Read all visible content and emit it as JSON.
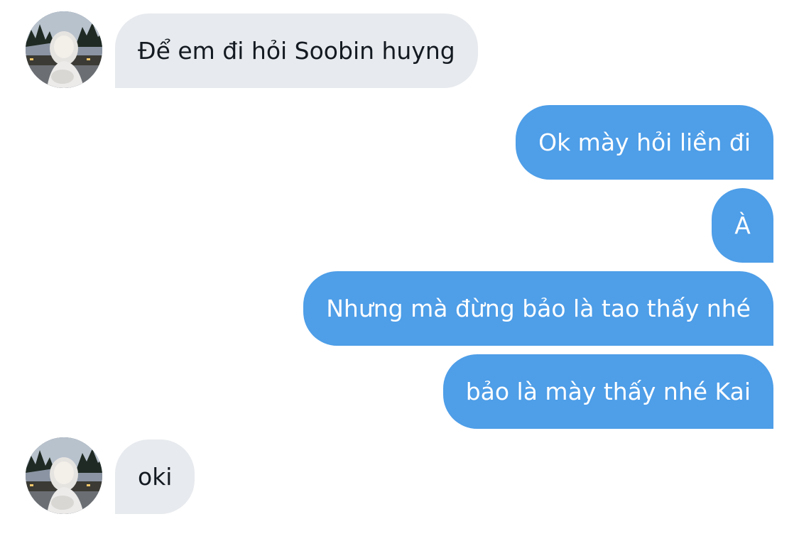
{
  "conversation": {
    "messages": [
      {
        "direction": "incoming",
        "text": "Để em đi hỏi Soobin huyng"
      },
      {
        "direction": "outgoing",
        "text": "Ok mày hỏi liền đi"
      },
      {
        "direction": "outgoing",
        "text": "À"
      },
      {
        "direction": "outgoing",
        "text": "Nhưng mà đừng bảo là tao thấy nhé"
      },
      {
        "direction": "outgoing",
        "text": "bảo là mày thấy nhé Kai"
      },
      {
        "direction": "incoming",
        "text": "oki"
      }
    ]
  },
  "colors": {
    "incoming_bubble": "#e7eaee",
    "outgoing_bubble": "#4e9ee8",
    "incoming_text": "#141a21",
    "outgoing_text": "#ffffff"
  },
  "icons": {
    "avatar": "contact-avatar-photo"
  }
}
